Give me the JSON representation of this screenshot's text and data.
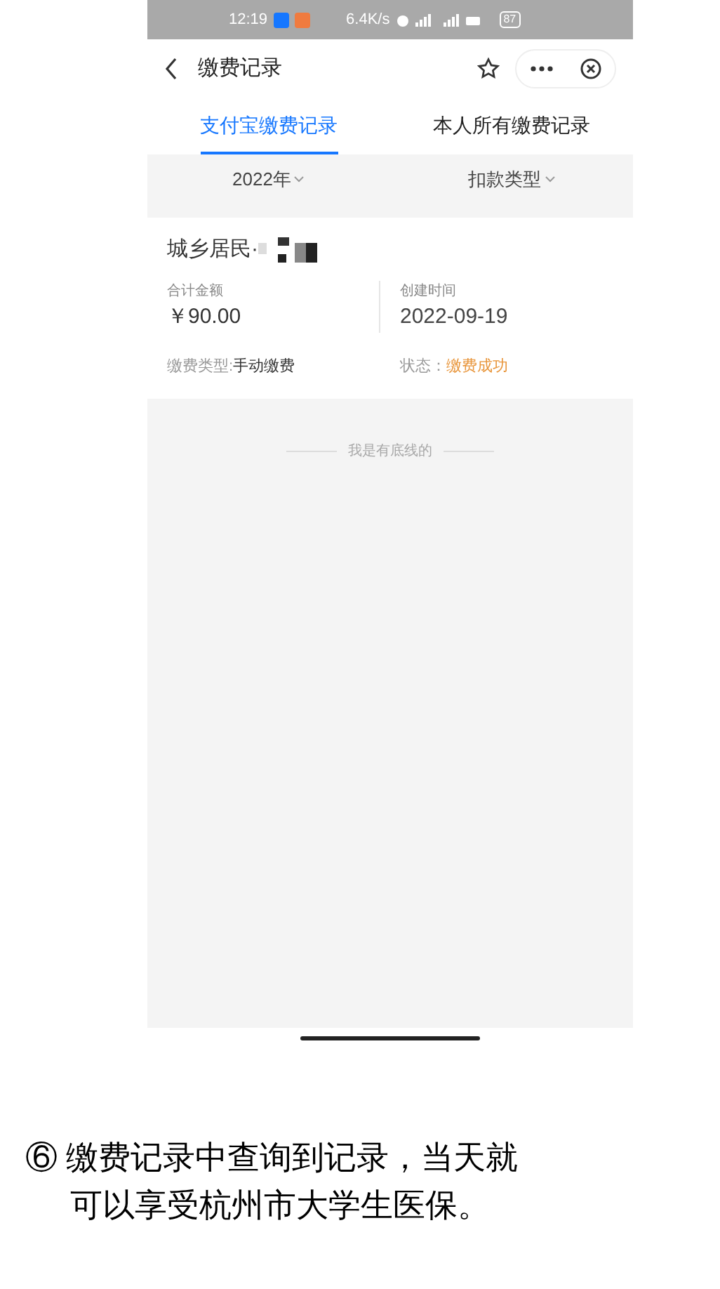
{
  "status_bar": {
    "time": "12:19",
    "speed": "6.4K/s",
    "battery": "87"
  },
  "header": {
    "title": "缴费记录"
  },
  "tabs": [
    {
      "label": "支付宝缴费记录",
      "selected": true
    },
    {
      "label": "本人所有缴费记录",
      "selected": false
    }
  ],
  "filters": [
    "2022年",
    "扣款类型"
  ],
  "record": {
    "title": "城乡居民·",
    "amount_label": "合计金额",
    "amount": "￥90.00",
    "date_label": "创建时间",
    "date": "2022-09-19",
    "type_label": "缴费类型:",
    "type": "手动缴费",
    "status_label": "状态：",
    "status": "缴费成功"
  },
  "footer": "我是有底线的",
  "caption": [
    "⑥ 缴费记录中查询到记录，当天就",
    "可以享受杭州市大学生医保。"
  ]
}
